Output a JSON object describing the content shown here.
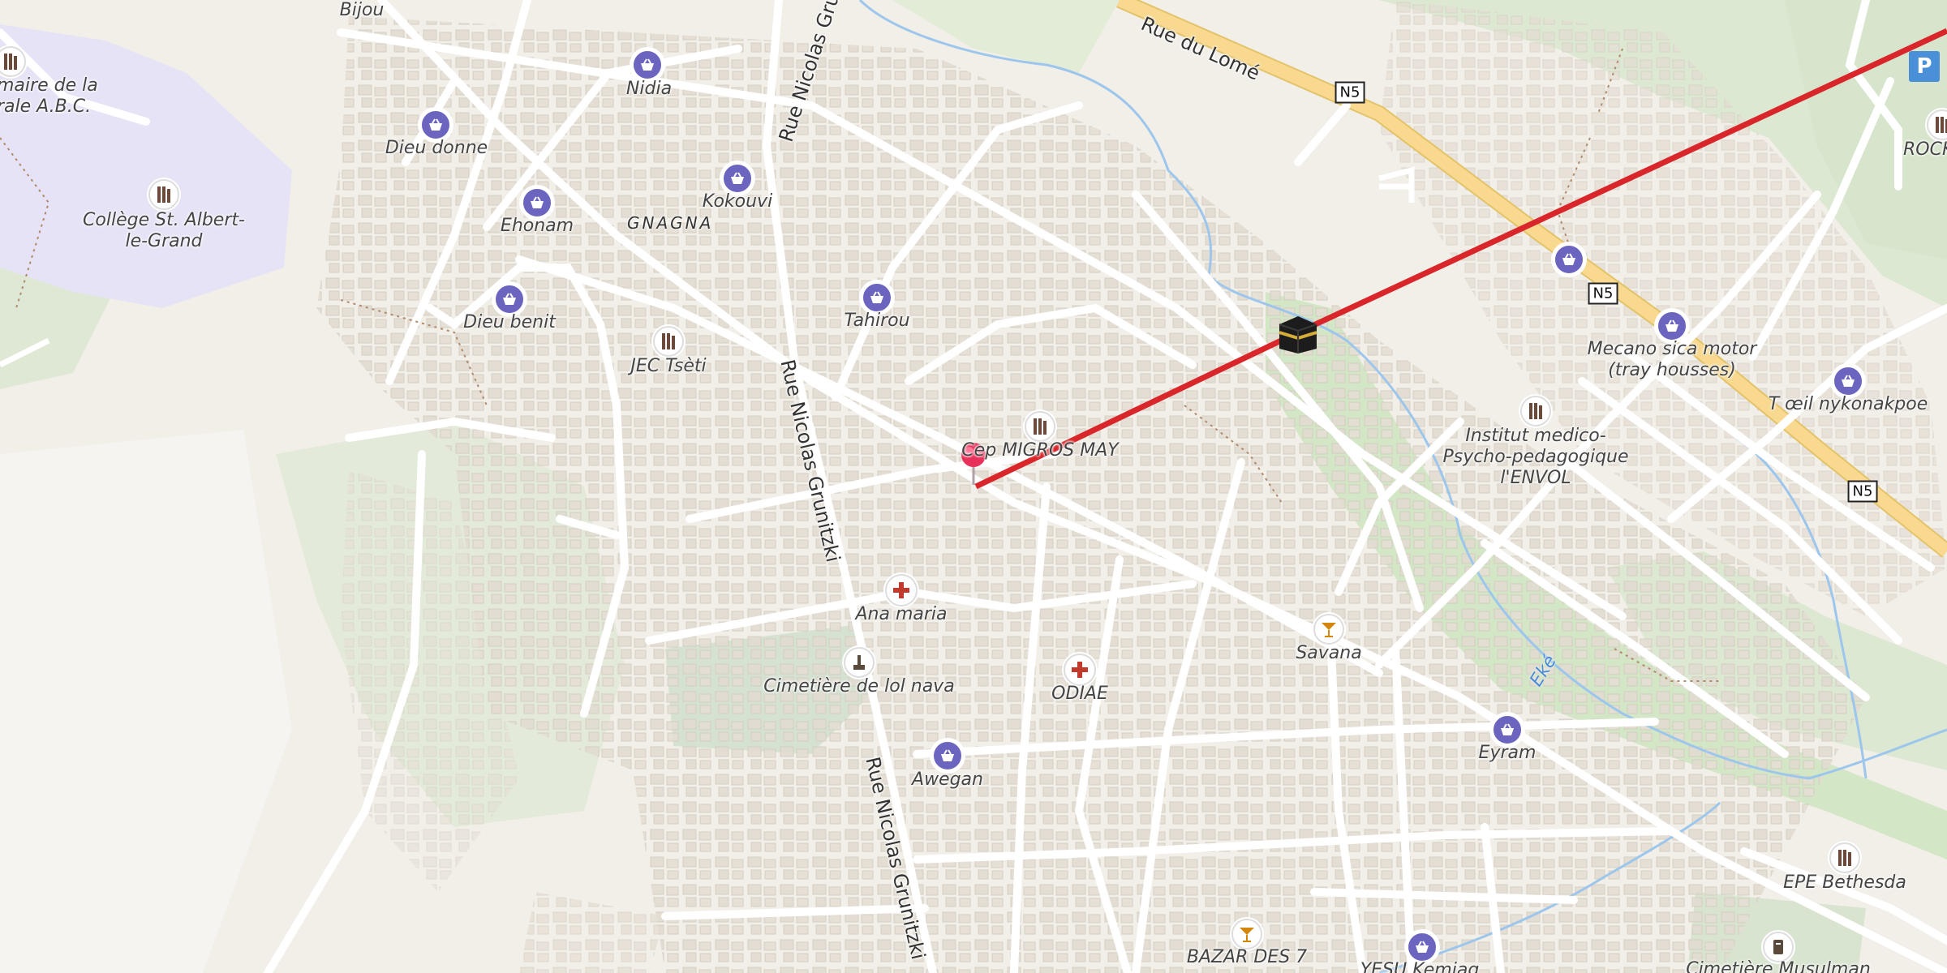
{
  "roads": {
    "rue_du_lome": "Rue du Lomé",
    "rue_nicolas_grunitzki_top": "Rue Nicolas Grunitzki",
    "rue_nicolas_grunitzki_mid": "Rue Nicolas Grunitzki",
    "rue_nicolas_grunitzki_bottom": "Rue Nicolas Grunitzki",
    "n5_1": "N5",
    "n5_2": "N5",
    "n5_3": "N5"
  },
  "areas": {
    "gnagna": "GNAGNA"
  },
  "water": {
    "eke": "Eké"
  },
  "pois": [
    {
      "id": "bijou",
      "label": "Bijou",
      "type": "shop"
    },
    {
      "id": "mairie",
      "label": "maire de la\nrale A.B.C.",
      "type": "school"
    },
    {
      "id": "nidia",
      "label": "Nidia",
      "type": "shop"
    },
    {
      "id": "dieu_donne",
      "label": "Dieu donne",
      "type": "shop"
    },
    {
      "id": "ehonam",
      "label": "Ehonam",
      "type": "shop"
    },
    {
      "id": "kokouvi",
      "label": "Kokouvi",
      "type": "shop"
    },
    {
      "id": "college",
      "label": "Collège St. Albert-\nle-Grand",
      "type": "school"
    },
    {
      "id": "dieu_benit",
      "label": "Dieu benit",
      "type": "shop"
    },
    {
      "id": "jec",
      "label": "JEC Tsèti",
      "type": "school"
    },
    {
      "id": "tahirou",
      "label": "Tahirou",
      "type": "shop"
    },
    {
      "id": "migros",
      "label": "Cep MIGROS MAY",
      "type": "school"
    },
    {
      "id": "ana_maria",
      "label": "Ana maria",
      "type": "health"
    },
    {
      "id": "cimetiere",
      "label": "Cimetière de lol nava",
      "type": "cemetery"
    },
    {
      "id": "odiae",
      "label": "ODIAE",
      "type": "health"
    },
    {
      "id": "awegan",
      "label": "Awegan",
      "type": "shop"
    },
    {
      "id": "savana",
      "label": "Savana",
      "type": "bar"
    },
    {
      "id": "eyram",
      "label": "Eyram",
      "type": "shop"
    },
    {
      "id": "mecano",
      "label": "Mecano sica motor\n(tray housses)",
      "type": "shop"
    },
    {
      "id": "institut",
      "label": "Institut medico-\nPsycho-pedagogique\nl'ENVOL",
      "type": "school"
    },
    {
      "id": "toeil",
      "label": "T œil nykonakpoe",
      "type": "shop"
    },
    {
      "id": "rock",
      "label": "ROCK",
      "type": "school"
    },
    {
      "id": "epe",
      "label": "EPE Bethesda",
      "type": "school"
    },
    {
      "id": "bazar",
      "label": "BAZAR DES 7",
      "type": "bar"
    },
    {
      "id": "yesu",
      "label": "YESU Kemiag",
      "type": "shop"
    },
    {
      "id": "cim_musulman",
      "label": "Cimetière Musulman",
      "type": "cemetery"
    }
  ],
  "markers": {
    "pin_color": "#e8305a",
    "route_color": "#d9262b",
    "parking_label": "P"
  },
  "colors": {
    "background": "#f2efe9",
    "shop_icon": "#6b65bf",
    "health_icon": "#c0392b",
    "bar_icon": "#d4860b",
    "school_area": "#e7e3f7",
    "water": "#9cc6ec",
    "primary_road": "#f8d98f"
  }
}
